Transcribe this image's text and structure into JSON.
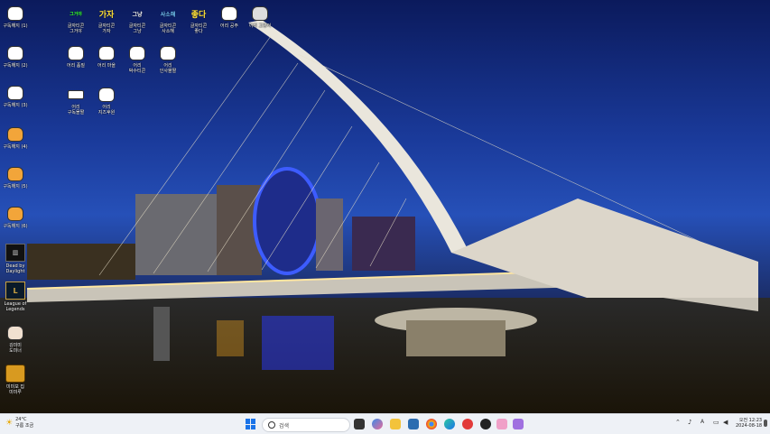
{
  "desktop": {
    "icons": [
      {
        "label": "구독해지 (1)",
        "icon_name": "cat-icon"
      },
      {
        "label": "구독해지 (2)",
        "icon_name": "cat-icon"
      },
      {
        "label": "구독해지 (3)",
        "icon_name": "cat-icon"
      },
      {
        "label": "구독해지 (4)",
        "icon_name": "cat-icon"
      },
      {
        "label": "구독해지 (5)",
        "icon_name": "cat-icon"
      },
      {
        "label": "구독해지 (6)",
        "icon_name": "cat-icon"
      },
      {
        "label": "Dead by Daylight",
        "icon_name": "dead-by-daylight-icon"
      },
      {
        "label": "League of Legends",
        "icon_name": "league-of-legends-icon"
      },
      {
        "label": "김미미\n도미너",
        "icon_name": "character-icon"
      },
      {
        "label": "미미보 집\n미미루",
        "icon_name": "treasure-icon"
      },
      {
        "label": "글자티콘\n그거야",
        "icon_name": "word-emoticon-icon",
        "glyph": "그거야"
      },
      {
        "label": "글자티콘\n가자",
        "icon_name": "word-emoticon-icon",
        "glyph": "가자"
      },
      {
        "label": "글자티콘\n그냥",
        "icon_name": "word-emoticon-icon",
        "glyph": "그냥"
      },
      {
        "label": "글자티콘\n사소해",
        "icon_name": "word-emoticon-icon",
        "glyph": "사소해"
      },
      {
        "label": "글자티콘\n좋다",
        "icon_name": "word-emoticon-icon",
        "glyph": "좋다"
      },
      {
        "label": "어리 공주",
        "icon_name": "cat-icon"
      },
      {
        "label": "어리 고양이",
        "icon_name": "cat-icon"
      },
      {
        "label": "어리 품질",
        "icon_name": "cat-icon"
      },
      {
        "label": "어리 마을",
        "icon_name": "cat-icon"
      },
      {
        "label": "어리\n박수티콘",
        "icon_name": "cat-icon"
      },
      {
        "label": "어리\n인사몰짤",
        "icon_name": "cat-icon"
      },
      {
        "label": "어리\n구독몰짤",
        "icon_name": "cat-icon"
      },
      {
        "label": "어리\n지즈후원",
        "icon_name": "cat-icon"
      }
    ]
  },
  "taskbar": {
    "weather": {
      "temp": "24°C",
      "desc": "구름 조금"
    },
    "search_placeholder": "검색",
    "clock": {
      "time": "오전 12:23",
      "date": "2024-08-18"
    },
    "colors": {
      "bg": "#eef1f6",
      "accent": "#1a73e8"
    }
  }
}
